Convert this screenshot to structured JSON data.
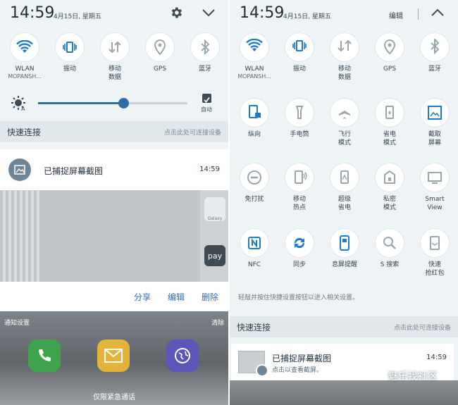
{
  "left": {
    "time": "14:59",
    "date": "4月15日, 星期五",
    "tiles": [
      {
        "label": "WLAN",
        "sub": "MOPANSH...",
        "icon": "wifi-icon"
      },
      {
        "label": "振动",
        "sub": "",
        "icon": "vibrate-icon"
      },
      {
        "label": "移动",
        "sub": "数据",
        "icon": "mobile-data-icon"
      },
      {
        "label": "GPS",
        "sub": "",
        "icon": "location-icon"
      },
      {
        "label": "蓝牙",
        "sub": "",
        "icon": "bluetooth-icon"
      }
    ],
    "brightness": {
      "level": 0.57,
      "auto_label": "自动"
    },
    "quick_connect": {
      "title": "快速连接",
      "hint": "点击此处可连接设备"
    },
    "notification": {
      "title": "已捕捉屏幕截图",
      "time": "14:59"
    },
    "actions": {
      "share": "分享",
      "edit": "编辑",
      "delete": "删除"
    },
    "footer": {
      "settings": "通知设置",
      "clear": "清除"
    },
    "emergency": "仅限紧急通话",
    "pay_label": "pay",
    "galaxy_label": "Galaxy"
  },
  "right": {
    "time": "14:59",
    "date": "4月15日, 星期五",
    "edit_label": "编辑",
    "rows": [
      [
        {
          "label": "WLAN",
          "sub": "MOPANSH...",
          "icon": "wifi-icon"
        },
        {
          "label": "振动",
          "sub": "",
          "icon": "vibrate-icon"
        },
        {
          "label": "移动",
          "sub": "数据",
          "icon": "mobile-data-icon"
        },
        {
          "label": "GPS",
          "sub": "",
          "icon": "location-icon"
        },
        {
          "label": "蓝牙",
          "sub": "",
          "icon": "bluetooth-icon"
        }
      ],
      [
        {
          "label": "纵向",
          "sub": "",
          "icon": "portrait-lock-icon"
        },
        {
          "label": "手电筒",
          "sub": "",
          "icon": "flashlight-icon"
        },
        {
          "label": "飞行",
          "sub": "模式",
          "icon": "airplane-icon"
        },
        {
          "label": "省电",
          "sub": "模式",
          "icon": "power-saving-icon"
        },
        {
          "label": "截取",
          "sub": "屏幕",
          "icon": "screenshot-icon"
        }
      ],
      [
        {
          "label": "免打扰",
          "sub": "",
          "icon": "do-not-disturb-icon"
        },
        {
          "label": "移动",
          "sub": "热点",
          "icon": "hotspot-icon"
        },
        {
          "label": "超级",
          "sub": "省电",
          "icon": "ultra-power-saving-icon"
        },
        {
          "label": "私密",
          "sub": "模式",
          "icon": "private-mode-icon"
        },
        {
          "label": "Smart",
          "sub": "View",
          "icon": "smart-view-icon"
        }
      ],
      [
        {
          "label": "NFC",
          "sub": "",
          "icon": "nfc-icon"
        },
        {
          "label": "同步",
          "sub": "",
          "icon": "sync-icon"
        },
        {
          "label": "息屏提醒",
          "sub": "",
          "icon": "always-on-display-icon"
        },
        {
          "label": "S 搜索",
          "sub": "",
          "icon": "search-icon"
        },
        {
          "label": "快速",
          "sub": "抢红包",
          "icon": "red-packet-icon"
        }
      ]
    ],
    "hint": "轻敲并按住快捷设置按钮以进入相关设置。",
    "quick_connect": {
      "title": "快速连接",
      "hint": "点击此处可连接设备"
    },
    "notification": {
      "title": "已捕捉屏幕截图",
      "subtitle": "点击以查看截屏。",
      "time": "14:59"
    },
    "watermark": "魅乐找社区"
  }
}
